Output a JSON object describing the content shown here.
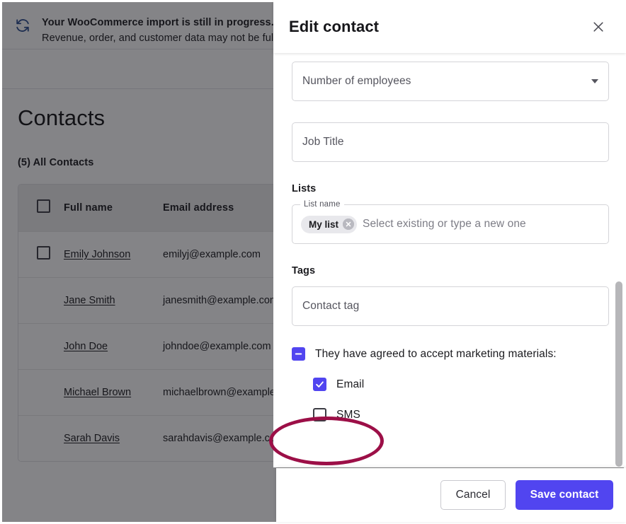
{
  "background_page": {
    "banner": {
      "icon": "sync-refresh-icon",
      "title": "Your WooCommerce import is still in progress.",
      "subtitle": "Revenue, order, and customer data may not be fully"
    },
    "page_title": "Contacts",
    "list_count_label": "(5) All Contacts",
    "table": {
      "columns": [
        "Full name",
        "Email address"
      ],
      "rows": [
        {
          "name": "Emily Johnson",
          "email": "emilyj@example.com",
          "has_checkbox": true
        },
        {
          "name": "Jane Smith",
          "email": "janesmith@example.com",
          "has_checkbox": false
        },
        {
          "name": "John Doe",
          "email": "johndoe@example.com",
          "has_checkbox": false
        },
        {
          "name": "Michael Brown",
          "email": "michaelbrown@example…",
          "has_checkbox": false
        },
        {
          "name": "Sarah Davis",
          "email": "sarahdavis@example.com",
          "has_checkbox": false
        }
      ]
    }
  },
  "modal": {
    "title": "Edit contact",
    "close_icon": "close-x-icon",
    "employees_field": {
      "placeholder": "Number of employees",
      "caret_icon": "chevron-down-icon"
    },
    "job_title_field": {
      "placeholder": "Job Title"
    },
    "lists_section": {
      "heading": "Lists",
      "legend": "List name",
      "chip": {
        "label": "My list",
        "remove_icon": "chip-remove-icon"
      },
      "placeholder": "Select existing or type a new one"
    },
    "tags_section": {
      "heading": "Tags",
      "placeholder": "Contact tag"
    },
    "consent": {
      "parent_label": "They have agreed to accept marketing materials:",
      "parent_state": "indeterminate",
      "options": [
        {
          "label": "Email",
          "checked": true,
          "check_icon": "checkmark-icon"
        },
        {
          "label": "SMS",
          "checked": false,
          "check_icon": ""
        }
      ]
    },
    "footer": {
      "cancel_label": "Cancel",
      "save_label": "Save contact"
    },
    "scrollbar": {
      "name": "modal-scrollbar"
    }
  },
  "annotation": {
    "type": "ellipse-highlight",
    "target": "SMS checkbox",
    "color": "#9c0f47"
  },
  "colors": {
    "accent": "#5145f0",
    "highlight": "#9c0f47",
    "banner_icon": "#2b4d8e"
  }
}
